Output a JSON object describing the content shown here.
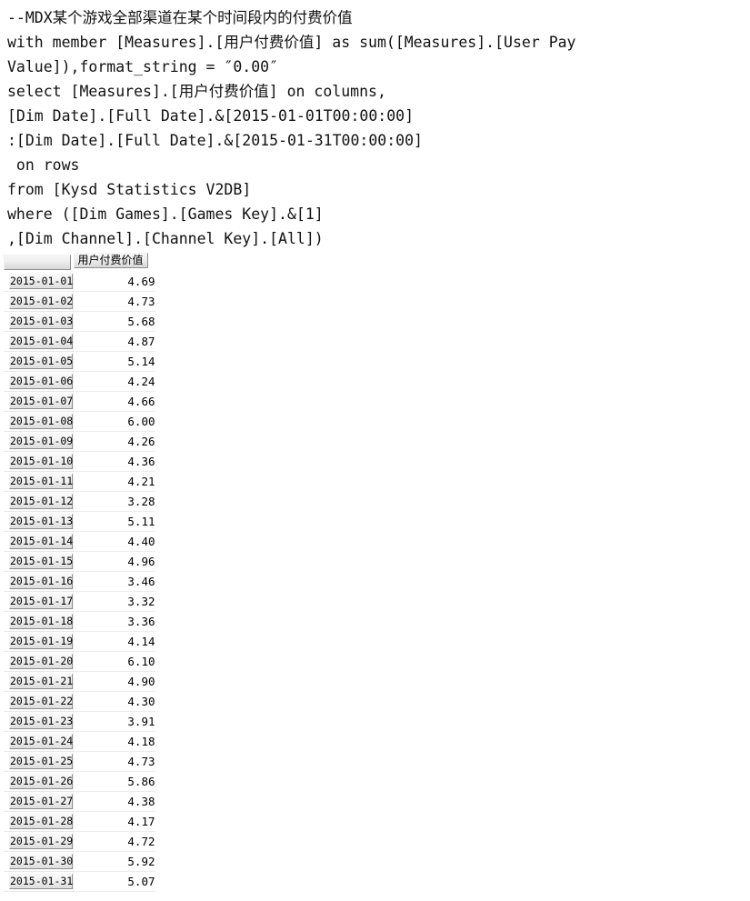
{
  "query": {
    "lines": [
      "--MDX某个游戏全部渠道在某个时间段内的付费价值",
      "with member [Measures].[用户付费价值] as sum([Measures].[User Pay",
      "Value]),format_string = ″0.00″",
      "select [Measures].[用户付费价值] on columns,",
      "[Dim Date].[Full Date].&[2015-01-01T00:00:00]",
      ":[Dim Date].[Full Date].&[2015-01-31T00:00:00]",
      " on rows",
      "from [Kysd Statistics V2DB]",
      "where ([Dim Games].[Games Key].&[1]",
      ",[Dim Channel].[Channel Key].[All])"
    ]
  },
  "grid": {
    "corner_label": "",
    "measure_header": "用户付费价值",
    "rows": [
      {
        "date": "2015-01-01",
        "value": "4.69"
      },
      {
        "date": "2015-01-02",
        "value": "4.73"
      },
      {
        "date": "2015-01-03",
        "value": "5.68"
      },
      {
        "date": "2015-01-04",
        "value": "4.87"
      },
      {
        "date": "2015-01-05",
        "value": "5.14"
      },
      {
        "date": "2015-01-06",
        "value": "4.24"
      },
      {
        "date": "2015-01-07",
        "value": "4.66"
      },
      {
        "date": "2015-01-08",
        "value": "6.00"
      },
      {
        "date": "2015-01-09",
        "value": "4.26"
      },
      {
        "date": "2015-01-10",
        "value": "4.36"
      },
      {
        "date": "2015-01-11",
        "value": "4.21"
      },
      {
        "date": "2015-01-12",
        "value": "3.28"
      },
      {
        "date": "2015-01-13",
        "value": "5.11"
      },
      {
        "date": "2015-01-14",
        "value": "4.40"
      },
      {
        "date": "2015-01-15",
        "value": "4.96"
      },
      {
        "date": "2015-01-16",
        "value": "3.46"
      },
      {
        "date": "2015-01-17",
        "value": "3.32"
      },
      {
        "date": "2015-01-18",
        "value": "3.36"
      },
      {
        "date": "2015-01-19",
        "value": "4.14"
      },
      {
        "date": "2015-01-20",
        "value": "6.10"
      },
      {
        "date": "2015-01-21",
        "value": "4.90"
      },
      {
        "date": "2015-01-22",
        "value": "4.30"
      },
      {
        "date": "2015-01-23",
        "value": "3.91"
      },
      {
        "date": "2015-01-24",
        "value": "4.18"
      },
      {
        "date": "2015-01-25",
        "value": "4.73"
      },
      {
        "date": "2015-01-26",
        "value": "5.86"
      },
      {
        "date": "2015-01-27",
        "value": "4.38"
      },
      {
        "date": "2015-01-28",
        "value": "4.17"
      },
      {
        "date": "2015-01-29",
        "value": "4.72"
      },
      {
        "date": "2015-01-30",
        "value": "5.92"
      },
      {
        "date": "2015-01-31",
        "value": "5.07"
      }
    ]
  }
}
